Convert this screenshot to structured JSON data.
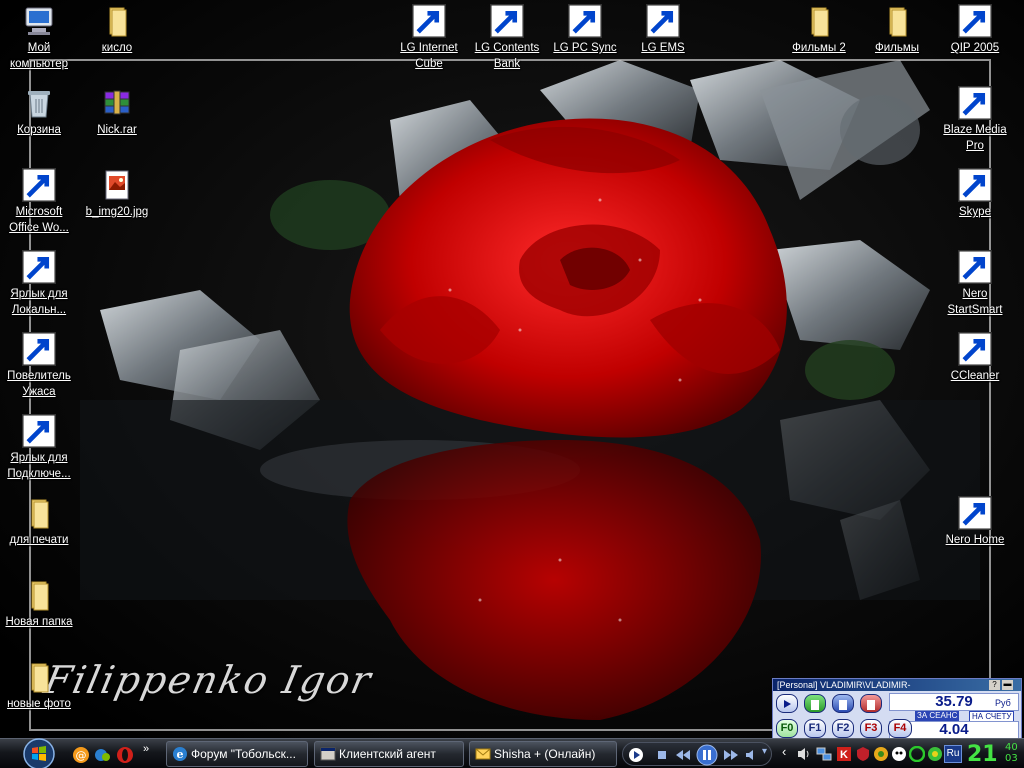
{
  "desktop": {
    "icons_left": [
      {
        "label": "Мой компьютер",
        "icon": "my-computer-icon"
      },
      {
        "label": "Корзина",
        "icon": "recycle-bin-icon"
      },
      {
        "label": "Microsoft Office Wo...",
        "icon": "word-doc-icon"
      },
      {
        "label": "Ярлык для Локальн...",
        "icon": "network-drive-icon"
      },
      {
        "label": "Повелитель Ужаса",
        "icon": "game-icon"
      },
      {
        "label": "Ярлык для Подключе...",
        "icon": "network-connection-icon"
      },
      {
        "label": "для печати",
        "icon": "folder-icon"
      },
      {
        "label": "Новая папка",
        "icon": "folder-icon"
      },
      {
        "label": "новые фото",
        "icon": "folder-icon"
      }
    ],
    "icons_col2": [
      {
        "label": "кисло",
        "icon": "folder-icon"
      },
      {
        "label": "Nick.rar",
        "icon": "winrar-archive-icon"
      },
      {
        "label": "b_img20.jpg",
        "icon": "image-file-icon"
      }
    ],
    "icons_top": [
      {
        "label": "LG Internet Cube",
        "icon": "lg-internet-cube-icon"
      },
      {
        "label": "LG Contents Bank",
        "icon": "lg-logo-icon"
      },
      {
        "label": "LG PC Sync",
        "icon": "lg-logo-icon"
      },
      {
        "label": "LG EMS",
        "icon": "lg-ems-icon"
      },
      {
        "label": "Фильмы 2",
        "icon": "folder-icon"
      },
      {
        "label": "Фильмы",
        "icon": "folder-icon"
      },
      {
        "label": "QIP 2005",
        "icon": "qip-icon"
      }
    ],
    "icons_right": [
      {
        "label": "Blaze Media Pro",
        "icon": "blaze-media-icon"
      },
      {
        "label": "Skype",
        "icon": "skype-icon"
      },
      {
        "label": "Nero StartSmart",
        "icon": "nero-icon"
      },
      {
        "label": "CCleaner",
        "icon": "ccleaner-icon"
      },
      {
        "label": "Nero Home",
        "icon": "nero-home-icon"
      }
    ],
    "wallpaper_signature": "Filippenko Igor"
  },
  "meter": {
    "title": "[Personal] VLADIMIR\\VLADIMIR-",
    "amount": "35.79",
    "currency": "Руб",
    "session_label": "ЗА СЕАНС",
    "account_label": "НА СЧЕТУ",
    "session_value": "4.04",
    "function_keys": [
      "F0",
      "F1",
      "F2",
      "F3",
      "F4"
    ]
  },
  "taskbar": {
    "tasks": [
      {
        "label": "Форум \"Тобольск...",
        "icon": "ie-icon"
      },
      {
        "label": "Клиентский агент",
        "icon": "agent-window-icon"
      },
      {
        "label": "Shisha + (Онлайн)",
        "icon": "mail-agent-icon"
      }
    ],
    "language": "Ru",
    "clock": {
      "hour": "21",
      "min1": "40",
      "min2": "03"
    }
  },
  "colors": {
    "accent_green": "#44e344",
    "meter_blue": "#0a246a",
    "rose_red": "#d40000"
  }
}
